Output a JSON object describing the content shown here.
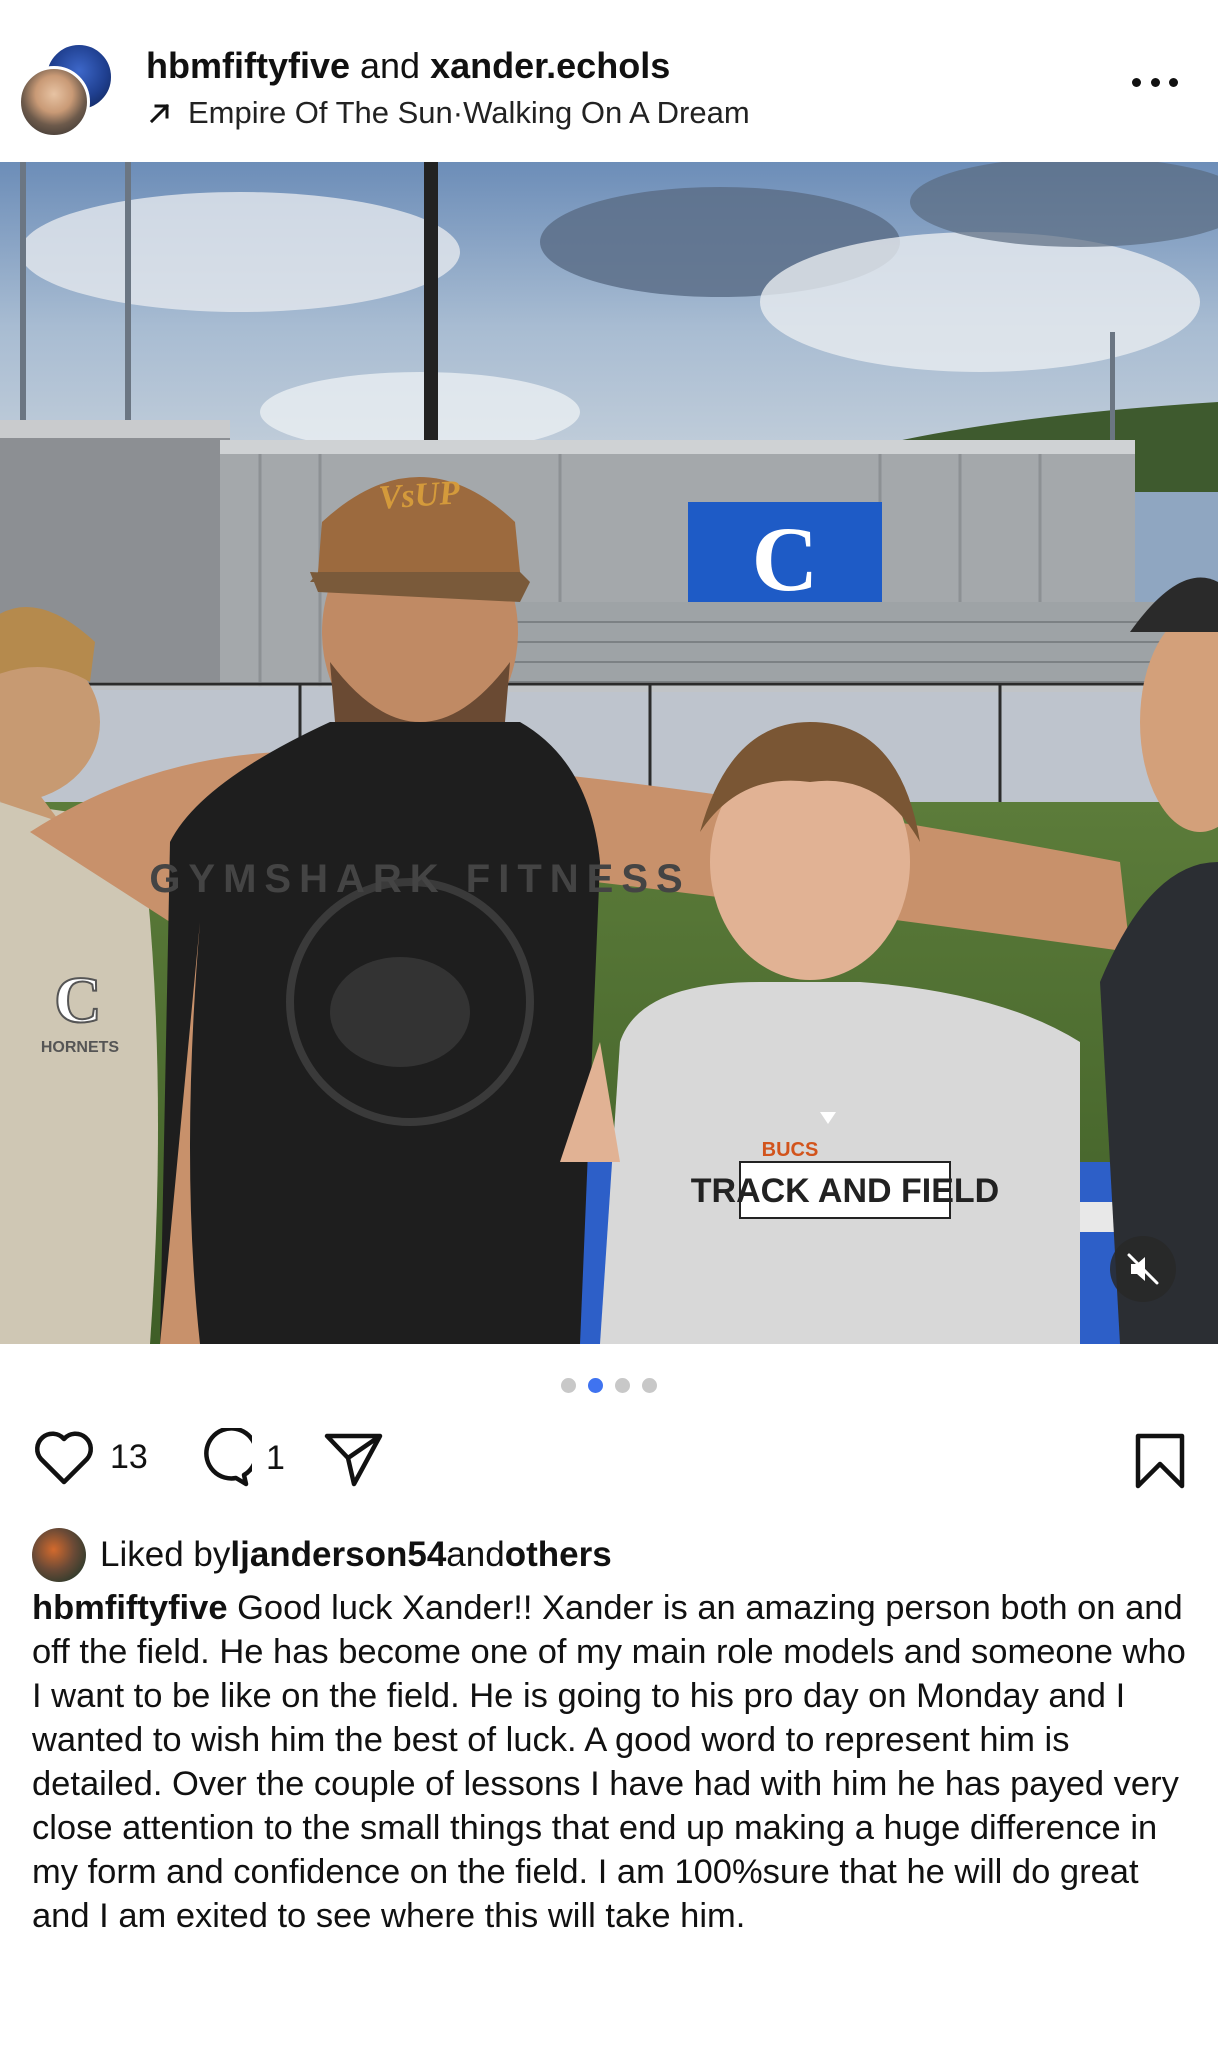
{
  "post": {
    "author_primary": "hbmfiftyfive",
    "names_joiner": " and ",
    "author_secondary": "xander.echols",
    "music_artist": "Empire Of The Sun",
    "music_separator": " · ",
    "music_track": "Walking On A Dream",
    "more_icon": "ellipsis-horizontal-icon"
  },
  "carousel": {
    "total": 4,
    "active_index": 1
  },
  "actions": {
    "like_count": "13",
    "comment_count": "1"
  },
  "likes": {
    "prefix": "Liked by ",
    "user": "ljanderson54",
    "joiner": " and ",
    "others": "others"
  },
  "caption": {
    "author": "hbmfiftyfive",
    "text": " Good luck Xander!! Xander is an amazing person both on and off the field. He has become one of my main role models and someone who I want to be like on the field. He is going to his pro day on Monday and I wanted to wish him the best of luck. A good word to represent him is detailed. Over the couple of lessons I have had with him he has payed very close attention to the small things that end up making a huge difference in my form and confidence on the field. I am 100%sure that he will do great and I am exited to see where this will take him."
  },
  "photo_text": {
    "cap_logo": "VsUP",
    "banner_letter": "C",
    "tank_shirt": "GYMSHARK FITNESS",
    "tee_brand": "BUCS",
    "tee_text": "TRACK AND FIELD",
    "left_shirt_letter": "C",
    "left_shirt_word": "HORNETS"
  },
  "colors": {
    "accent": "#3f73f0",
    "dot_inactive": "#c8c8c8",
    "text": "#111111"
  }
}
